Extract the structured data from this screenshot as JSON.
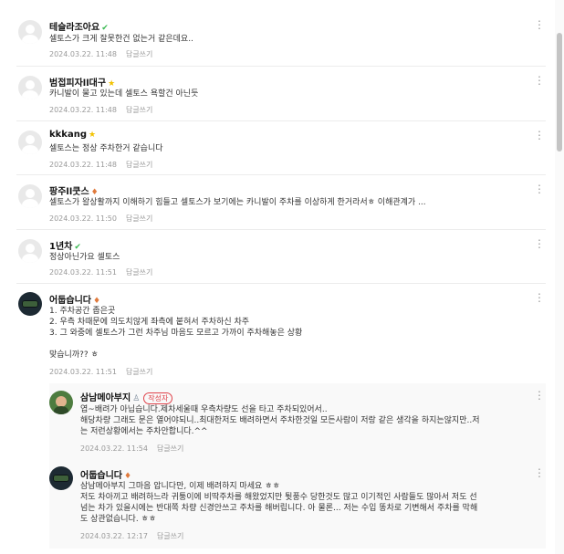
{
  "more_icon": "more-vertical-icon",
  "comments": [
    {
      "nick": "테슬라조아요",
      "badge": "✔",
      "badge_color": "#3cba54",
      "text": [
        "셀토스가 크게 잘못한건 없는거 같은데요.."
      ],
      "date": "2024.03.22. 11:48",
      "reply": "답글쓰기"
    },
    {
      "nick": "범접피자ll대구",
      "badge": "★",
      "badge_color": "#f2c200",
      "text": [
        "카니발이 물고 있는데 셀토스 욕할건 아닌듯"
      ],
      "date": "2024.03.22. 11:48",
      "reply": "답글쓰기"
    },
    {
      "nick": "kkkang",
      "badge": "★",
      "badge_color": "#f2c200",
      "text": [
        "셀토스는 정상 주차한거 같습니다"
      ],
      "date": "2024.03.22. 11:48",
      "reply": "답글쓰기"
    },
    {
      "nick": "팡주ll쿳스",
      "badge": "♦",
      "badge_color": "#e07a3c",
      "text": [
        "셀토스가 왈상활까지 이해하기 힘들고 셀토스가 보기에는 카니발이 주차를 이상하게 한거라서ㅎ 이해관계가 ..."
      ],
      "date": "2024.03.22. 11:50",
      "reply": "답글쓰기"
    },
    {
      "nick": "1년차",
      "badge": "✔",
      "badge_color": "#3cba54",
      "text": [
        "정상아닌가요 셀토스"
      ],
      "date": "2024.03.22. 11:51",
      "reply": "답글쓰기"
    },
    {
      "nick": "어둡습니다",
      "badge": "♦",
      "badge_color": "#e07a3c",
      "text": [
        "1. 주차공간 좁은곳",
        "2. 우측 차때문에 의도치않게 좌측에 붙혀서 주차하신 차주",
        "3. 그 와중에 셀토스가 그런 차주님 마음도 모르고 가까이 주차해놓은 상황",
        "",
        "맞습니까?? ㅎ"
      ],
      "date": "2024.03.22. 11:51",
      "reply": "답글쓰기"
    }
  ],
  "replies": [
    {
      "nick": "삼남메아부지",
      "badge": "♙",
      "badge_color": "#7a8a9a",
      "writer_tag": "작성자",
      "text": [
        "엽~배려가 아닙습니다.제차세울때 우측차량도 선을 타고 주차되있어서..",
        "해당차량 그래도 문은 열어야되니..최대한저도 배려하면서 주차한것일 모든사람이 저랑 같은 생각을 하지는않지만..저",
        "는 저런상황에서는 주차안합니다.^^"
      ],
      "date": "2024.03.22. 11:54",
      "reply": "답글쓰기"
    },
    {
      "nick": "어둡습니다",
      "badge": "♦",
      "badge_color": "#e07a3c",
      "text": [
        "삼남메아부지 그마음 압니다만, 이제 배려하지 마세요 ㅎㅎ",
        "저도 차아끼고 배려하느라 귀퉁이에 비딱주차를 해왔었지만 튓풍수 당한것도 많고 이기적인 사람들도 많아서 저도 선",
        "넘는 차가 있을시에는 반대쪽 차량 신경안쓰고 주차를 해버립니다. 아 물론... 저는 수입 똥차로 기변해서 주차를 막해",
        "도 상관없습니다. ㅎㅎ"
      ],
      "date": "2024.03.22. 12:17",
      "reply": "답글쓰기"
    }
  ]
}
